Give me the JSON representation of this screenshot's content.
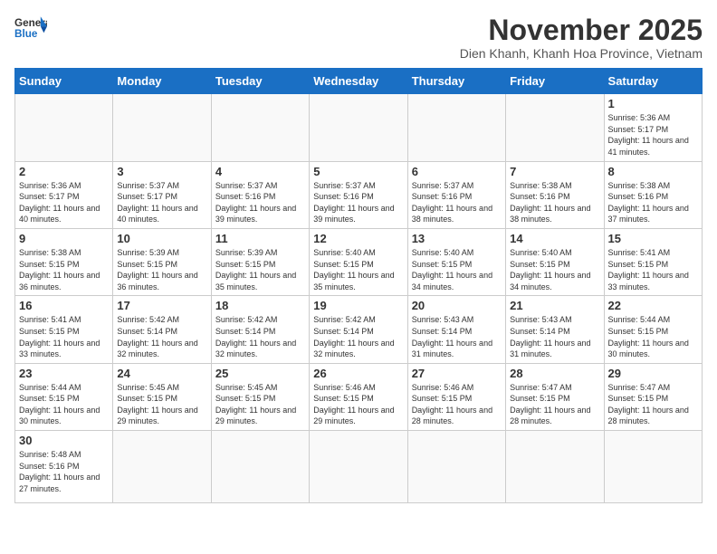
{
  "header": {
    "logo_general": "General",
    "logo_blue": "Blue",
    "month_title": "November 2025",
    "subtitle": "Dien Khanh, Khanh Hoa Province, Vietnam"
  },
  "days_of_week": [
    "Sunday",
    "Monday",
    "Tuesday",
    "Wednesday",
    "Thursday",
    "Friday",
    "Saturday"
  ],
  "weeks": [
    [
      {
        "day": "",
        "info": ""
      },
      {
        "day": "",
        "info": ""
      },
      {
        "day": "",
        "info": ""
      },
      {
        "day": "",
        "info": ""
      },
      {
        "day": "",
        "info": ""
      },
      {
        "day": "",
        "info": ""
      },
      {
        "day": "1",
        "info": "Sunrise: 5:36 AM\nSunset: 5:17 PM\nDaylight: 11 hours\nand 41 minutes."
      }
    ],
    [
      {
        "day": "2",
        "info": "Sunrise: 5:36 AM\nSunset: 5:17 PM\nDaylight: 11 hours\nand 40 minutes."
      },
      {
        "day": "3",
        "info": "Sunrise: 5:37 AM\nSunset: 5:17 PM\nDaylight: 11 hours\nand 40 minutes."
      },
      {
        "day": "4",
        "info": "Sunrise: 5:37 AM\nSunset: 5:16 PM\nDaylight: 11 hours\nand 39 minutes."
      },
      {
        "day": "5",
        "info": "Sunrise: 5:37 AM\nSunset: 5:16 PM\nDaylight: 11 hours\nand 39 minutes."
      },
      {
        "day": "6",
        "info": "Sunrise: 5:37 AM\nSunset: 5:16 PM\nDaylight: 11 hours\nand 38 minutes."
      },
      {
        "day": "7",
        "info": "Sunrise: 5:38 AM\nSunset: 5:16 PM\nDaylight: 11 hours\nand 38 minutes."
      },
      {
        "day": "8",
        "info": "Sunrise: 5:38 AM\nSunset: 5:16 PM\nDaylight: 11 hours\nand 37 minutes."
      }
    ],
    [
      {
        "day": "9",
        "info": "Sunrise: 5:38 AM\nSunset: 5:15 PM\nDaylight: 11 hours\nand 36 minutes."
      },
      {
        "day": "10",
        "info": "Sunrise: 5:39 AM\nSunset: 5:15 PM\nDaylight: 11 hours\nand 36 minutes."
      },
      {
        "day": "11",
        "info": "Sunrise: 5:39 AM\nSunset: 5:15 PM\nDaylight: 11 hours\nand 35 minutes."
      },
      {
        "day": "12",
        "info": "Sunrise: 5:40 AM\nSunset: 5:15 PM\nDaylight: 11 hours\nand 35 minutes."
      },
      {
        "day": "13",
        "info": "Sunrise: 5:40 AM\nSunset: 5:15 PM\nDaylight: 11 hours\nand 34 minutes."
      },
      {
        "day": "14",
        "info": "Sunrise: 5:40 AM\nSunset: 5:15 PM\nDaylight: 11 hours\nand 34 minutes."
      },
      {
        "day": "15",
        "info": "Sunrise: 5:41 AM\nSunset: 5:15 PM\nDaylight: 11 hours\nand 33 minutes."
      }
    ],
    [
      {
        "day": "16",
        "info": "Sunrise: 5:41 AM\nSunset: 5:15 PM\nDaylight: 11 hours\nand 33 minutes."
      },
      {
        "day": "17",
        "info": "Sunrise: 5:42 AM\nSunset: 5:14 PM\nDaylight: 11 hours\nand 32 minutes."
      },
      {
        "day": "18",
        "info": "Sunrise: 5:42 AM\nSunset: 5:14 PM\nDaylight: 11 hours\nand 32 minutes."
      },
      {
        "day": "19",
        "info": "Sunrise: 5:42 AM\nSunset: 5:14 PM\nDaylight: 11 hours\nand 32 minutes."
      },
      {
        "day": "20",
        "info": "Sunrise: 5:43 AM\nSunset: 5:14 PM\nDaylight: 11 hours\nand 31 minutes."
      },
      {
        "day": "21",
        "info": "Sunrise: 5:43 AM\nSunset: 5:14 PM\nDaylight: 11 hours\nand 31 minutes."
      },
      {
        "day": "22",
        "info": "Sunrise: 5:44 AM\nSunset: 5:15 PM\nDaylight: 11 hours\nand 30 minutes."
      }
    ],
    [
      {
        "day": "23",
        "info": "Sunrise: 5:44 AM\nSunset: 5:15 PM\nDaylight: 11 hours\nand 30 minutes."
      },
      {
        "day": "24",
        "info": "Sunrise: 5:45 AM\nSunset: 5:15 PM\nDaylight: 11 hours\nand 29 minutes."
      },
      {
        "day": "25",
        "info": "Sunrise: 5:45 AM\nSunset: 5:15 PM\nDaylight: 11 hours\nand 29 minutes."
      },
      {
        "day": "26",
        "info": "Sunrise: 5:46 AM\nSunset: 5:15 PM\nDaylight: 11 hours\nand 29 minutes."
      },
      {
        "day": "27",
        "info": "Sunrise: 5:46 AM\nSunset: 5:15 PM\nDaylight: 11 hours\nand 28 minutes."
      },
      {
        "day": "28",
        "info": "Sunrise: 5:47 AM\nSunset: 5:15 PM\nDaylight: 11 hours\nand 28 minutes."
      },
      {
        "day": "29",
        "info": "Sunrise: 5:47 AM\nSunset: 5:15 PM\nDaylight: 11 hours\nand 28 minutes."
      }
    ],
    [
      {
        "day": "30",
        "info": "Sunrise: 5:48 AM\nSunset: 5:16 PM\nDaylight: 11 hours\nand 27 minutes."
      },
      {
        "day": "",
        "info": ""
      },
      {
        "day": "",
        "info": ""
      },
      {
        "day": "",
        "info": ""
      },
      {
        "day": "",
        "info": ""
      },
      {
        "day": "",
        "info": ""
      },
      {
        "day": "",
        "info": ""
      }
    ]
  ]
}
